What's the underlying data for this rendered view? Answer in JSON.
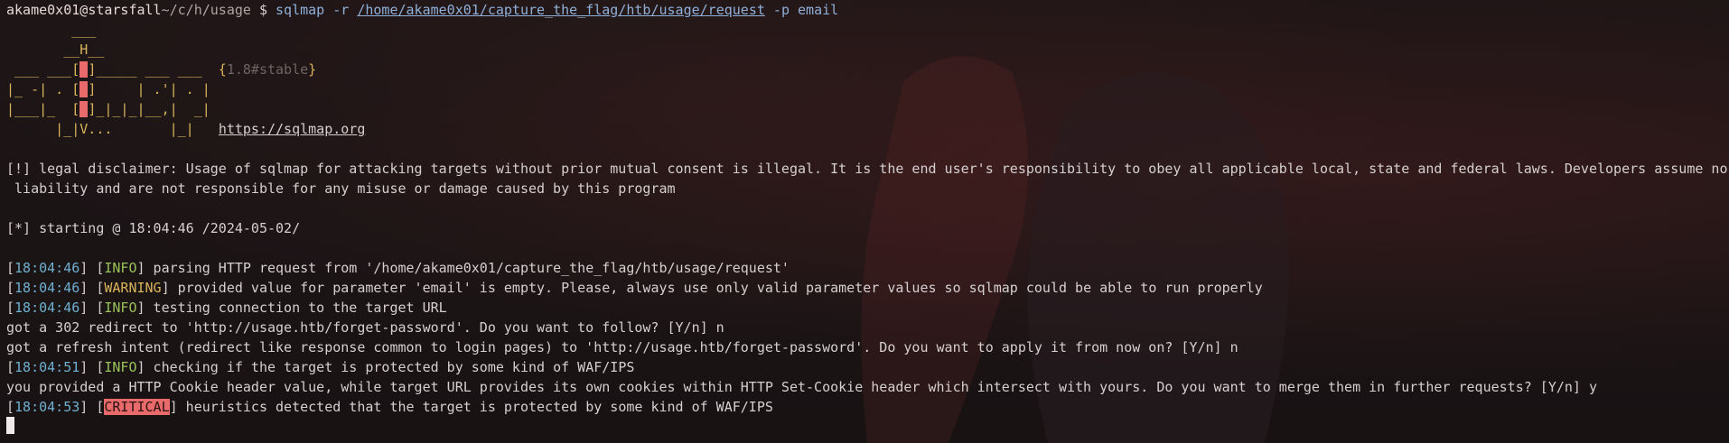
{
  "prompt": {
    "user": "akame0x01",
    "at": "@",
    "host": "starsfall",
    "cwd": "~/c/h/usage",
    "symbol": "$",
    "cmd": "sqlmap",
    "flag_r": "-r",
    "request_path": "/home/akame0x01/capture_the_flag/htb/usage/request",
    "flag_p": "-p",
    "param": "email"
  },
  "banner": {
    "l1": "        ___",
    "l2": "       __H__",
    "l3a": " ___ ___[",
    "l3b": ")",
    "l3c": "]_____ ___ ___  {",
    "l3ver": "1.8#stable",
    "l3d": "}",
    "l4a": "|_ -| . [",
    "l4b": "'",
    "l4c": "]     | .'| . |",
    "l5a": "|___|_  [",
    "l5b": "'",
    "l5c": "]_|_|_|__,|  _|",
    "l6": "      |_|V...       |_|   ",
    "url": "https://sqlmap.org"
  },
  "disclaimer_1": "[!] legal disclaimer: Usage of sqlmap for attacking targets without prior mutual consent is illegal. It is the end user's responsibility to obey all applicable local, state and federal laws. Developers assume no",
  "disclaimer_2": " liability and are not responsible for any misuse or damage caused by this program",
  "starting": "[*] starting @ 18:04:46 /2024-05-02/",
  "log": {
    "l1_ts": "18:04:46",
    "l1_lvl": "INFO",
    "l1_msg": " parsing HTTP request from '/home/akame0x01/capture_the_flag/htb/usage/request'",
    "l2_ts": "18:04:46",
    "l2_lvl": "WARNING",
    "l2_msg": " provided value for parameter 'email' is empty. Please, always use only valid parameter values so sqlmap could be able to run properly",
    "l3_ts": "18:04:46",
    "l3_lvl": "INFO",
    "l3_msg": " testing connection to the target URL",
    "q1": "got a 302 redirect to 'http://usage.htb/forget-password'. Do you want to follow? [Y/n] n",
    "q2": "got a refresh intent (redirect like response common to login pages) to 'http://usage.htb/forget-password'. Do you want to apply it from now on? [Y/n] n",
    "l4_ts": "18:04:51",
    "l4_lvl": "INFO",
    "l4_msg": " checking if the target is protected by some kind of WAF/IPS",
    "q3": "you provided a HTTP Cookie header value, while target URL provides its own cookies within HTTP Set-Cookie header which intersect with yours. Do you want to merge them in further requests? [Y/n] y",
    "l5_ts": "18:04:53",
    "l5_lvl": "CRITICAL",
    "l5_msg": " heuristics detected that the target is protected by some kind of WAF/IPS"
  }
}
